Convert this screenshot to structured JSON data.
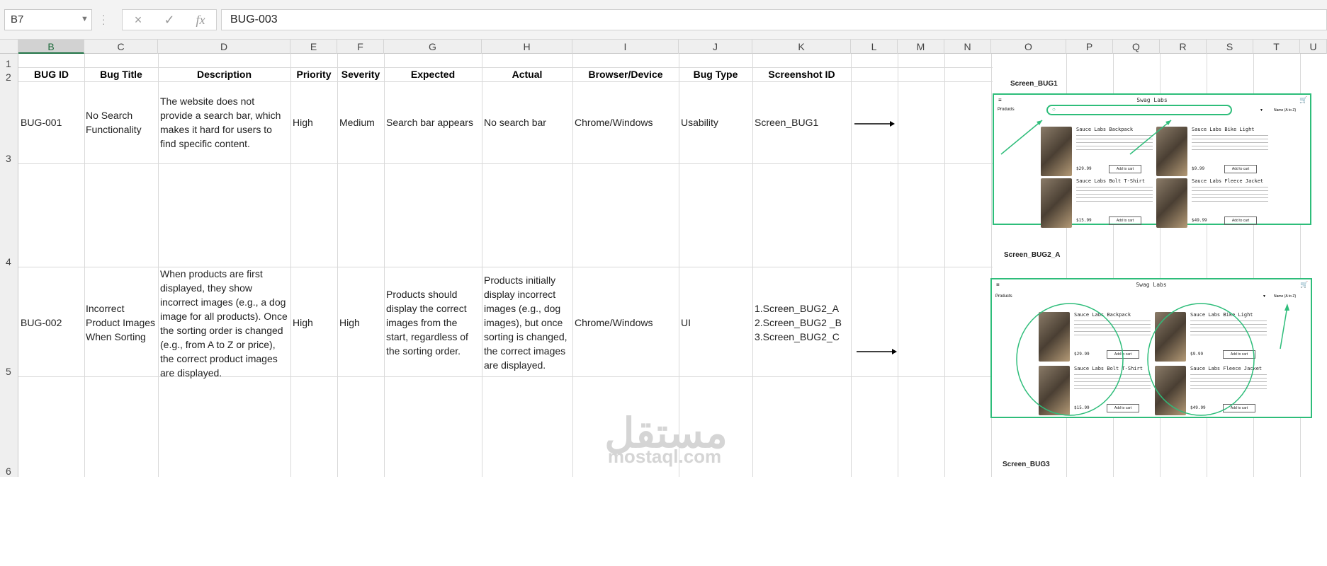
{
  "formula_bar": {
    "name_box": "B7",
    "formula": "BUG-003",
    "cancel_icon": "×",
    "enter_icon": "✓",
    "function_icon": "fx"
  },
  "column_headers": [
    "B",
    "C",
    "D",
    "E",
    "F",
    "G",
    "H",
    "I",
    "J",
    "K",
    "L",
    "M",
    "N",
    "O",
    "P",
    "Q",
    "R",
    "S",
    "T",
    "U"
  ],
  "row_headers": [
    "1",
    "2",
    "3",
    "4",
    "5",
    "6"
  ],
  "table_headers": {
    "bug_id": "BUG ID",
    "bug_title": "Bug Title",
    "description": "Description",
    "priority": "Priority",
    "severity": "Severity",
    "expected": "Expected",
    "actual": "Actual",
    "browser": "Browser/Device",
    "bug_type": "Bug Type",
    "screenshot_id": "Screenshot ID"
  },
  "rows": [
    {
      "bug_id": "BUG-001",
      "bug_title": [
        "No Search",
        "Functionality"
      ],
      "description": [
        "The website does not",
        "provide a search bar, which",
        "makes it hard for users to",
        "find specific content."
      ],
      "priority": "High",
      "severity": "Medium",
      "expected": "Search bar appears",
      "actual": "No search bar",
      "browser": "Chrome/Windows",
      "bug_type": "Usability",
      "screenshot_id": [
        "Screen_BUG1"
      ]
    },
    {
      "bug_id": "BUG-002",
      "bug_title": [
        "Incorrect",
        "Product Images",
        "When Sorting"
      ],
      "description": [
        "When products are first",
        "displayed, they show",
        "incorrect images (e.g., a dog",
        "image for all products). Once",
        "the sorting order is changed",
        "(e.g., from A to Z or price),",
        "the correct product images",
        "are displayed."
      ],
      "priority": "High",
      "severity": "High",
      "expected": [
        "Products should",
        "display the correct",
        "images from the",
        "start, regardless of",
        "the sorting order."
      ],
      "actual": [
        "Products initially",
        "display incorrect",
        "images (e.g., dog",
        "images), but once",
        "sorting is changed,",
        "the correct images",
        "are displayed."
      ],
      "browser": "Chrome/Windows",
      "bug_type": "UI",
      "screenshot_id": [
        "1.Screen_BUG2_A",
        "2.Screen_BUG2 _B",
        "3.Screen_BUG2_C"
      ]
    }
  ],
  "screenshot_labels": {
    "bug1": "Screen_BUG1",
    "bug2a": "Screen_BUG2_A",
    "bug3": "Screen_BUG3"
  },
  "shot": {
    "app_title": "Swag Labs",
    "products_label": "Products",
    "sort_label": "Name (A to Z)",
    "add_to_cart": "Add to cart",
    "products": [
      {
        "name": "Sauce Labs Backpack",
        "price": "$29.99"
      },
      {
        "name": "Sauce Labs Bike Light",
        "price": "$9.99"
      },
      {
        "name": "Sauce Labs Bolt T-Shirt",
        "price": "$15.99"
      },
      {
        "name": "Sauce Labs Fleece Jacket",
        "price": "$49.99"
      }
    ]
  },
  "watermark": {
    "arabic": "مستقل",
    "latin": "mostaql.com"
  },
  "colors": {
    "accent": "#217346",
    "annotation": "#2ebd7a"
  }
}
